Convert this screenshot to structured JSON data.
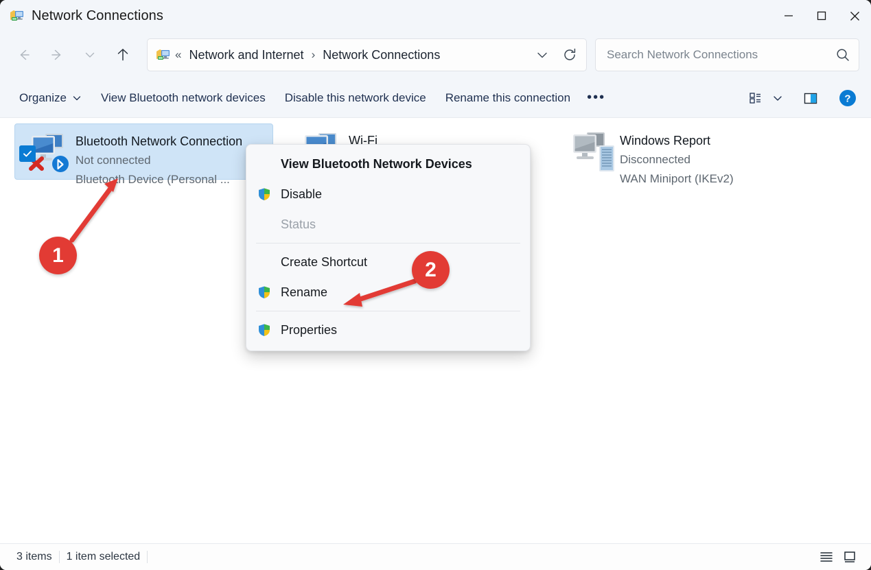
{
  "window": {
    "title": "Network Connections",
    "app_icon": "network-connections-icon",
    "controls": {
      "minimize": "−",
      "maximize": "☐",
      "close": "✕"
    }
  },
  "nav": {
    "back": "back-arrow",
    "forward": "forward-arrow",
    "recent": "chevron-down",
    "up": "up-arrow"
  },
  "address": {
    "icon": "network-connections-icon",
    "prefix": "«",
    "crumbs": [
      "Network and Internet",
      "Network Connections"
    ],
    "separator": "›",
    "dropdown": "chevron-down-icon",
    "refresh": "refresh-icon"
  },
  "search": {
    "placeholder": "Search Network Connections",
    "value": "",
    "icon": "search-icon"
  },
  "toolbar": {
    "organize": "Organize",
    "view_bluetooth": "View Bluetooth network devices",
    "disable_device": "Disable this network device",
    "rename_connection": "Rename this connection",
    "more": "•••",
    "view_icon": "view-layout-icon",
    "view_chevron": "chevron-down-icon",
    "details_pane_icon": "details-pane-icon",
    "help_icon": "help-icon",
    "accent_color": "#0a7bd3"
  },
  "connections": [
    {
      "name": "Bluetooth Network Connection",
      "status": "Not connected",
      "device": "Bluetooth Device (Personal ...",
      "selected": true,
      "icon": "bluetooth-network-adapter-icon"
    },
    {
      "name": "Wi-Fi",
      "status": "",
      "device": "",
      "selected": false,
      "icon": "wifi-adapter-icon"
    },
    {
      "name": "Windows Report",
      "status": "Disconnected",
      "device": "WAN Miniport (IKEv2)",
      "selected": false,
      "icon": "wan-miniport-icon"
    }
  ],
  "context_menu": {
    "items": [
      {
        "label": "View Bluetooth Network Devices",
        "bold": true,
        "shield": false,
        "disabled": false
      },
      {
        "label": "Disable",
        "bold": false,
        "shield": true,
        "disabled": false
      },
      {
        "label": "Status",
        "bold": false,
        "shield": false,
        "disabled": true
      },
      {
        "label": "Create Shortcut",
        "bold": false,
        "shield": false,
        "disabled": false
      },
      {
        "label": "Rename",
        "bold": false,
        "shield": true,
        "disabled": false
      },
      {
        "label": "Properties",
        "bold": false,
        "shield": true,
        "disabled": false
      }
    ]
  },
  "status_bar": {
    "item_count": "3 items",
    "selection": "1 item selected",
    "details_view_icon": "details-view-icon",
    "large_icons_view_icon": "large-icons-view-icon"
  },
  "annotations": {
    "marker_one": "1",
    "marker_two": "2",
    "color": "#e23b34"
  }
}
